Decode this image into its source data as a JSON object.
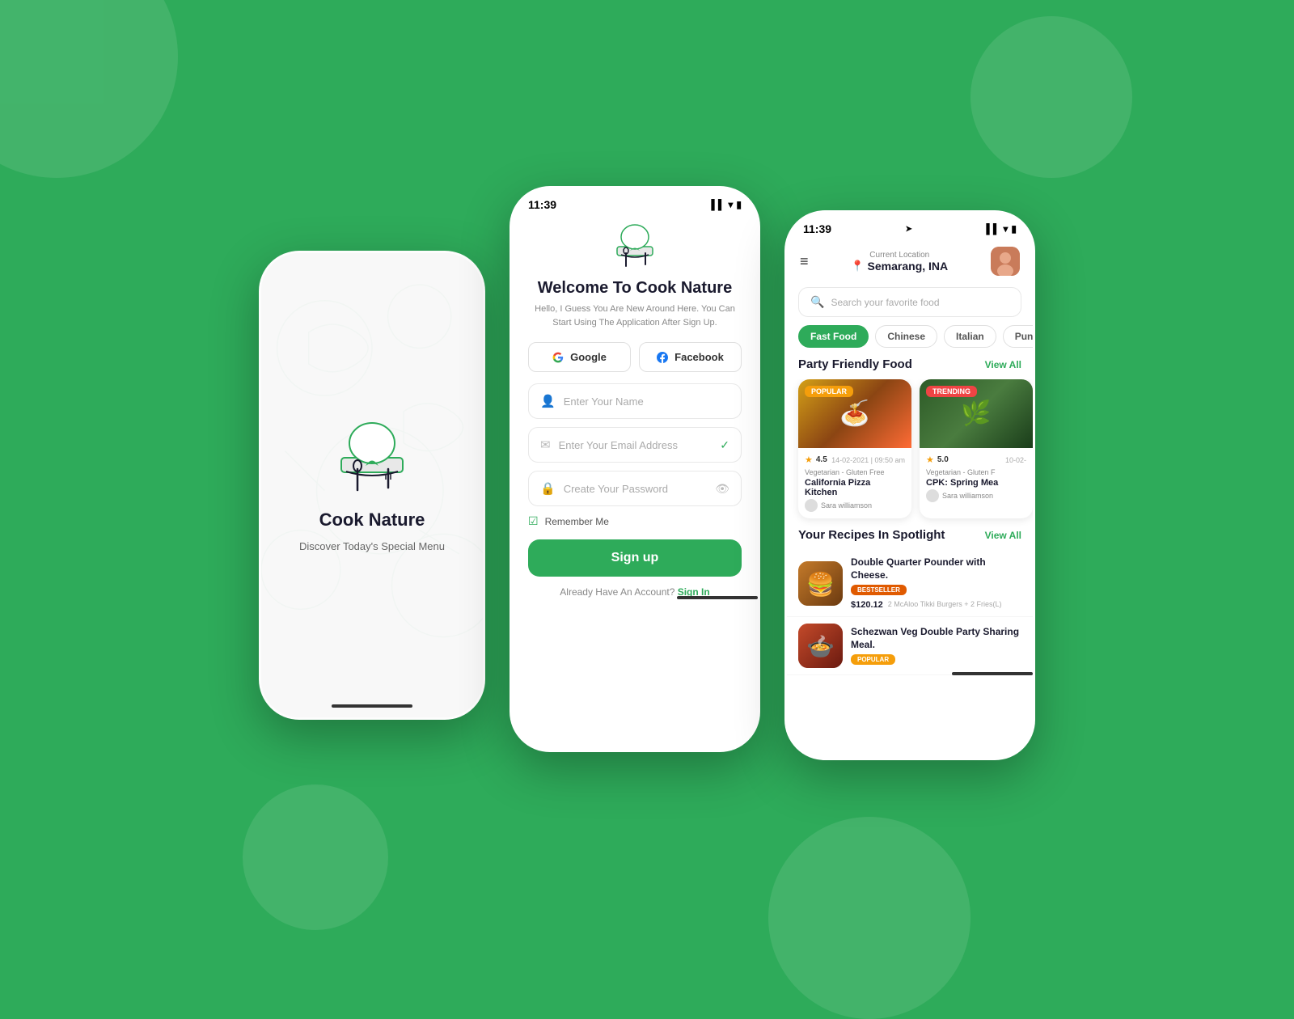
{
  "background": {
    "color": "#2eab5a"
  },
  "phone1": {
    "app_name": "Cook Nature",
    "tagline": "Discover Today's Special Menu"
  },
  "phone2": {
    "status_bar": {
      "time": "11:39",
      "signal": "▌▌",
      "wifi": "▾",
      "battery": "▮▮▮"
    },
    "welcome_title": "Welcome To Cook Nature",
    "welcome_sub": "Hello, I Guess You Are New Around Here. You Can Start Using The Application After Sign Up.",
    "google_label": "Google",
    "facebook_label": "Facebook",
    "name_placeholder": "Enter Your Name",
    "email_placeholder": "Enter Your Email Address",
    "password_placeholder": "Create Your Password",
    "remember_label": "Remember Me",
    "signup_label": "Sign up",
    "signin_prompt": "Already Have An Account?",
    "signin_link": "Sign In"
  },
  "phone3": {
    "status_bar": {
      "time": "11:39"
    },
    "location_label": "Current Location",
    "location_name": "Semarang, INA",
    "search_placeholder": "Search your favorite food",
    "categories": [
      {
        "label": "Fast Food",
        "active": true
      },
      {
        "label": "Chinese",
        "active": false
      },
      {
        "label": "Italian",
        "active": false
      },
      {
        "label": "Punjab",
        "active": false
      }
    ],
    "party_section": {
      "title": "Party Friendly Food",
      "view_all": "View All"
    },
    "food_cards": [
      {
        "badge": "POPULAR",
        "badge_type": "popular",
        "rating": "4.5",
        "date": "14-02-2021 | 09:50 am",
        "type": "Vegetarian - Gluten Free",
        "name": "California Pizza Kitchen",
        "author": "Sara williamson"
      },
      {
        "badge": "TRENDING",
        "badge_type": "trending",
        "rating": "5.0",
        "date": "10-02-",
        "type": "Vegetarian - Gluten F",
        "name": "CPK: Spring Mea",
        "author": "Sara williamson"
      }
    ],
    "spotlight_section": {
      "title": "Your Recipes In Spotlight",
      "view_all": "View All"
    },
    "spotlight_items": [
      {
        "name": "Double Quarter Pounder with Cheese.",
        "badge": "BESTSELLER",
        "badge_type": "bestseller",
        "price": "$120.12",
        "desc": "2 McAloo Tikki Burgers + 2 Fries(L)"
      },
      {
        "name": "Schezwan Veg Double Party Sharing Meal.",
        "badge": "POPULAR",
        "badge_type": "popular2",
        "price": "",
        "desc": ""
      }
    ]
  }
}
